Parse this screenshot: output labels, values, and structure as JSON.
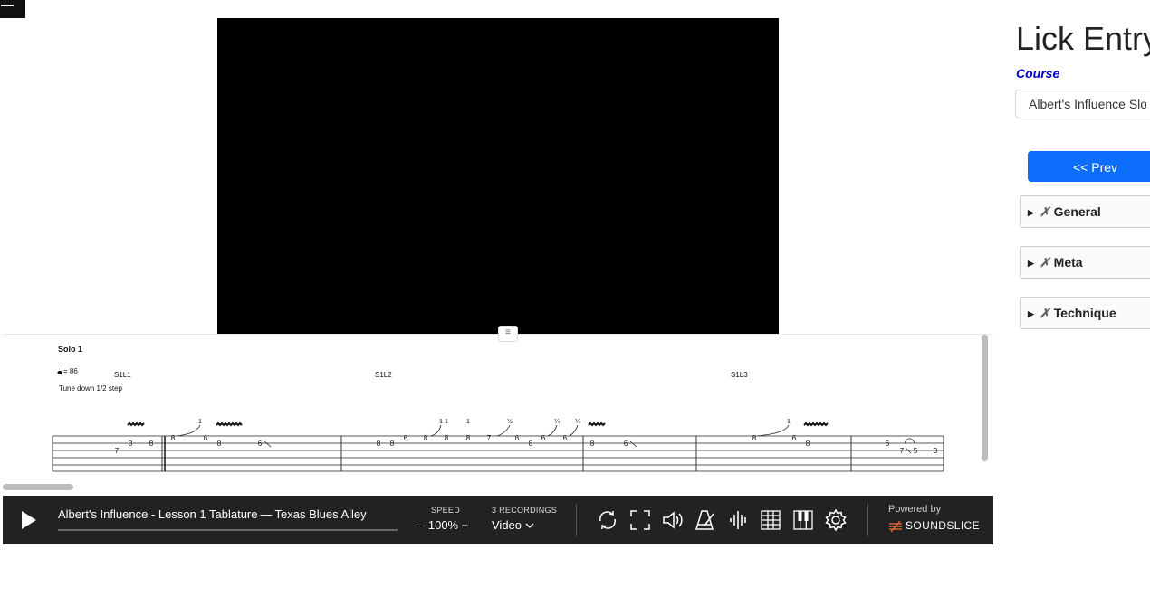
{
  "menu": {
    "icon": "hamburger-icon"
  },
  "notation": {
    "section_title": "Solo 1",
    "tempo_value": "= 86",
    "tuning_note": "Tune down 1/2 step",
    "markers": [
      "S1L1",
      "S1L2",
      "S1L3"
    ]
  },
  "player": {
    "title": "Albert's Influence - Lesson 1 Tablature",
    "separator": "—",
    "author": "Texas Blues Alley",
    "speed_label": "SPEED",
    "speed_minus": "–",
    "speed_value": "100%",
    "speed_plus": "+",
    "recordings_label": "3 RECORDINGS",
    "recording_selected": "Video",
    "powered_by": "Powered by",
    "brand": "SOUNDSLICE",
    "tools": [
      "loop-icon",
      "fullscreen-icon",
      "volume-icon",
      "metronome-icon",
      "waveform-icon",
      "tab-grid-icon",
      "piano-icon",
      "settings-icon"
    ]
  },
  "sidebar": {
    "page_title": "Lick Entry",
    "course_label": "Course",
    "course_value": "Albert's Influence Slow",
    "prev_label": "<< Prev",
    "sections": [
      {
        "marker": "✗",
        "label": "General"
      },
      {
        "marker": "✗",
        "label": "Meta"
      },
      {
        "marker": "✗",
        "label": "Technique"
      }
    ]
  }
}
